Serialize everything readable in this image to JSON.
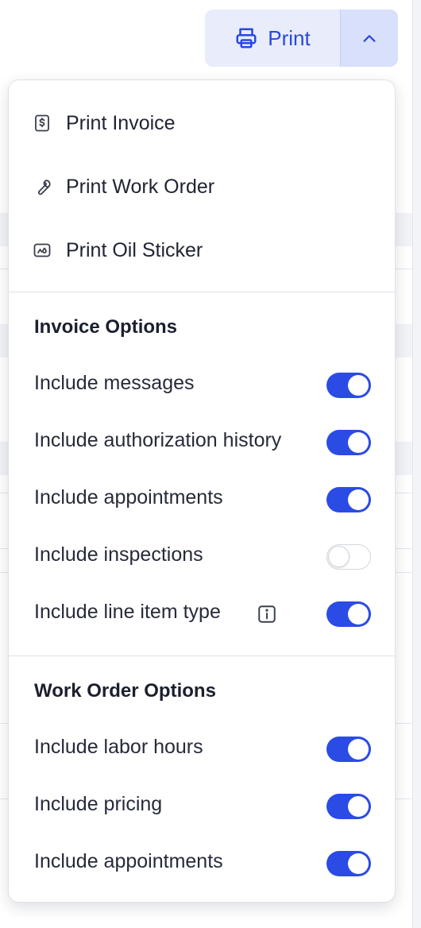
{
  "print_button": {
    "label": "Print",
    "icon": "printer-icon",
    "toggle_icon": "chevron-up-icon"
  },
  "menu": {
    "items": [
      {
        "label": "Print Invoice",
        "icon": "invoice-dollar-icon"
      },
      {
        "label": "Print Work Order",
        "icon": "wrench-icon"
      },
      {
        "label": "Print Oil Sticker",
        "icon": "oil-sticker-icon"
      }
    ]
  },
  "invoice_options": {
    "title": "Invoice Options",
    "options": [
      {
        "label": "Include messages",
        "enabled": true
      },
      {
        "label": "Include authorization history",
        "enabled": true
      },
      {
        "label": "Include appointments",
        "enabled": true
      },
      {
        "label": "Include inspections",
        "enabled": false
      },
      {
        "label": "Include line item type",
        "enabled": true,
        "info_icon": "info-icon"
      }
    ]
  },
  "work_order_options": {
    "title": "Work Order Options",
    "options": [
      {
        "label": "Include labor hours",
        "enabled": true
      },
      {
        "label": "Include pricing",
        "enabled": true
      },
      {
        "label": "Include appointments",
        "enabled": true
      }
    ]
  },
  "colors": {
    "accent": "#2b4be5",
    "button_bg": "#e8ecfb",
    "toggle_off_border": "#d4d7de"
  }
}
